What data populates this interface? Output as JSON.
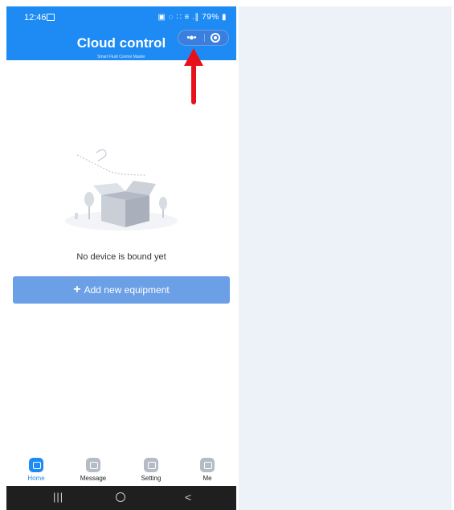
{
  "status_bar": {
    "time": "12:46",
    "right_icons": "▣ ◌ ∷ ≡ .∥",
    "battery": "79%"
  },
  "header": {
    "title": "Cloud control",
    "subtitle": "Smart Fluid Control Master"
  },
  "capsule": {
    "more_label": "•●•",
    "more_icon": "more-dots-icon",
    "close_icon": "target-close-icon"
  },
  "empty_state": {
    "message": "No device is bound yet"
  },
  "add_button": {
    "plus": "+",
    "label": "Add new equipment"
  },
  "tabs": [
    {
      "label": "Home",
      "icon": "home-icon",
      "active": true
    },
    {
      "label": "Message",
      "icon": "message-icon",
      "active": false
    },
    {
      "label": "Setting",
      "icon": "setting-icon",
      "active": false
    },
    {
      "label": "Me",
      "icon": "me-icon",
      "active": false
    }
  ],
  "nav_bar": {
    "recent": "|||",
    "home": "",
    "back": "<"
  },
  "colors": {
    "accent": "#1d8bf3",
    "button": "#6b9fe6",
    "arrow": "#e8111b",
    "panel": "#edf1f8"
  }
}
